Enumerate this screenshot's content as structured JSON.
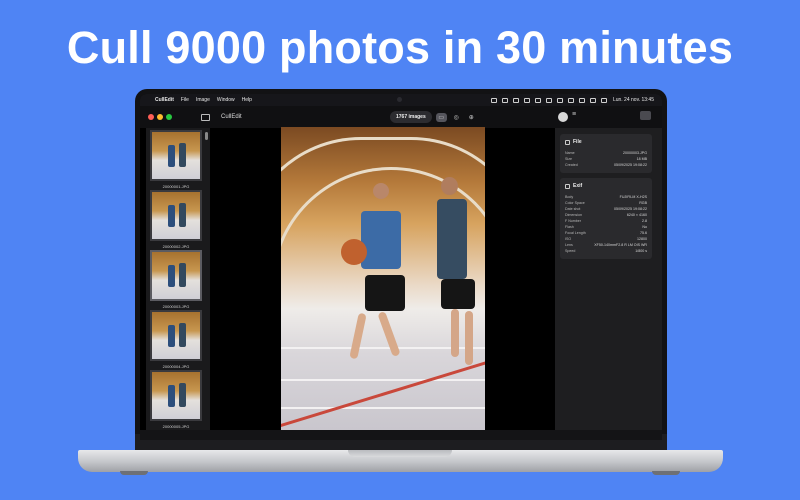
{
  "headline": "Cull 9000 photos in 30 minutes",
  "menubar": {
    "app_name": "CullEdit",
    "items": [
      "File",
      "Image",
      "Window",
      "Help"
    ],
    "clock": "Lun. 24 nov.  13:45"
  },
  "toolbar": {
    "title": "CullEdit",
    "image_count": "1767 images"
  },
  "filmstrip": [
    {
      "name": "20000001.JPG",
      "selected": false
    },
    {
      "name": "20000002.JPG",
      "selected": false
    },
    {
      "name": "20000003.JPG",
      "selected": true
    },
    {
      "name": "20000004.JPG",
      "selected": false
    },
    {
      "name": "20000005.JPG",
      "selected": false
    }
  ],
  "inspector": {
    "file": {
      "title": "File",
      "rows": [
        {
          "label": "Name",
          "value": "20000003.JPG"
        },
        {
          "label": "Size",
          "value": "18 MB"
        },
        {
          "label": "Created",
          "value": "05/09/2025 19:08:22"
        }
      ]
    },
    "exif": {
      "title": "Exif",
      "rows": [
        {
          "label": "Body",
          "value": "FUJIFILM X-H2S"
        },
        {
          "label": "Color Space",
          "value": "RGB"
        },
        {
          "label": "Date shot",
          "value": "05/09/2025 19:08:22"
        },
        {
          "label": "Dimension",
          "value": "6240 × 4160"
        },
        {
          "label": "F Number",
          "value": "2.8"
        },
        {
          "label": "Flash",
          "value": "No"
        },
        {
          "label": "Focal Length",
          "value": "75.6"
        },
        {
          "label": "ISO",
          "value": "12800"
        },
        {
          "label": "Lens",
          "value": "XF50-140mmF2.8 R LM OIS WR"
        },
        {
          "label": "Speed",
          "value": "1/800 s"
        }
      ]
    }
  },
  "colors": {
    "background": "#4f84f4",
    "window": "#000000",
    "sidebar": "#1a1a1c",
    "inspector": "#1e1e20",
    "traffic_red": "#ff5f57",
    "traffic_yellow": "#febc2e",
    "traffic_green": "#28c840"
  }
}
